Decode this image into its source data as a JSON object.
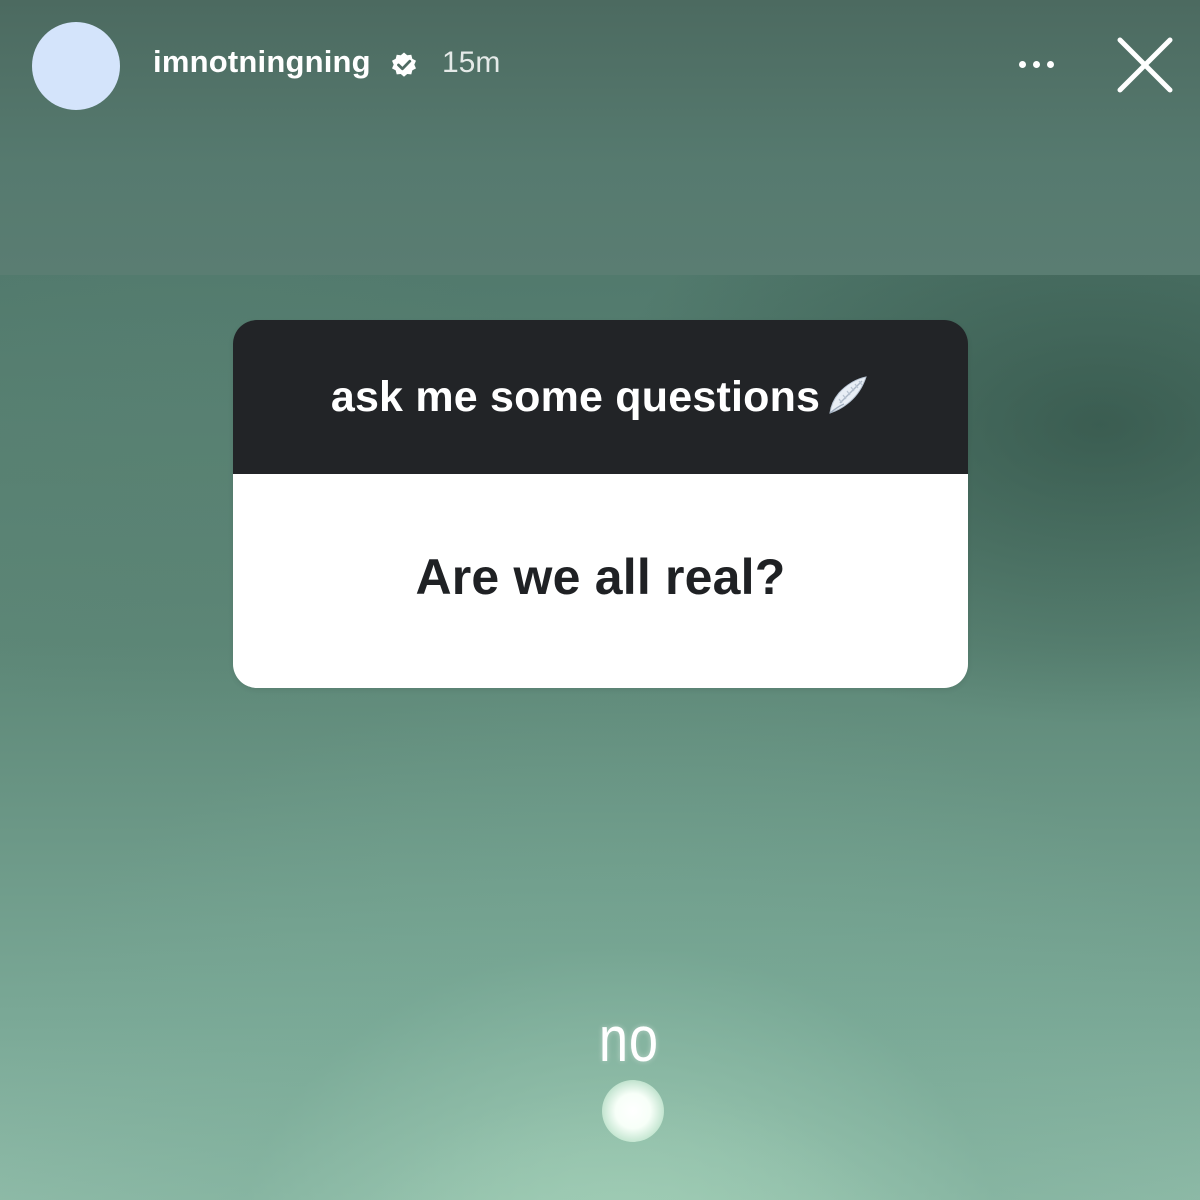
{
  "header": {
    "username": "imnotningning",
    "verified_icon": "verified-badge-icon",
    "timestamp": "15m",
    "more_icon": "more-options-icon",
    "close_icon": "close-icon",
    "avatar_color": "#d4e4fb"
  },
  "sticker": {
    "title": "ask me some questions",
    "title_icon": "wing-icon",
    "question": "Are we all real?",
    "header_color": "#222427",
    "body_color": "#ffffff"
  },
  "answer": {
    "text": "no"
  }
}
